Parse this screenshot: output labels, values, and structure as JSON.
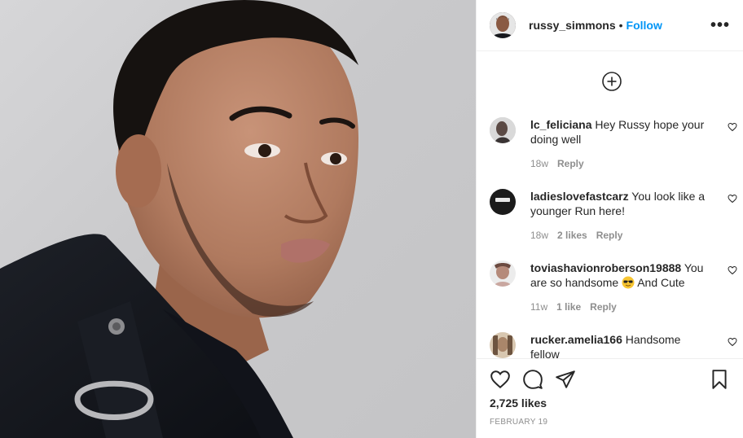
{
  "post": {
    "username": "russy_simmons",
    "separator": "•",
    "follow_label": "Follow",
    "more_label": "•••"
  },
  "icons": {
    "load_more": "plus-circle-icon",
    "like": "heart-icon",
    "comment": "comment-bubble-icon",
    "share": "paper-plane-icon",
    "save": "bookmark-icon",
    "comment_like": "small-heart-icon",
    "emoji": "sunglasses-emoji-icon"
  },
  "comments": [
    {
      "username": "lc_feliciana",
      "text": "Hey Russy hope your doing well",
      "time": "18w",
      "likes": "",
      "reply_label": "Reply"
    },
    {
      "username": "ladieslovefastcarz",
      "text": "You look like a younger Run here!",
      "time": "18w",
      "likes": "2 likes",
      "reply_label": "Reply"
    },
    {
      "username": "toviashavionroberson19888",
      "text_before": "You are so handsome",
      "text_after": "And Cute",
      "time": "11w",
      "likes": "1 like",
      "reply_label": "Reply"
    },
    {
      "username": "rucker.amelia166",
      "text": "Handsome fellow",
      "time": "",
      "likes": "",
      "reply_label": ""
    }
  ],
  "footer": {
    "likes_count": "2,725 likes",
    "date": "FEBRUARY 19"
  },
  "colors": {
    "accent": "#0095f6",
    "text": "#262626",
    "muted": "#8e8e8e",
    "border": "#efefef"
  }
}
